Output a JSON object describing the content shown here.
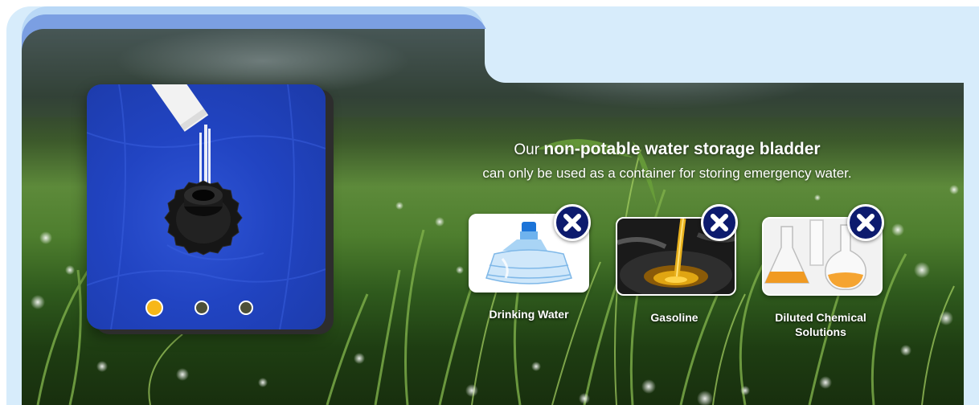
{
  "headline": {
    "prefix": "Our",
    "emphasis": "non-potable water storage bladder",
    "subline": "can only be used as a container for storing emergency water."
  },
  "items": [
    {
      "label": "Drinking Water",
      "icon": "close-icon"
    },
    {
      "label": "Gasoline",
      "icon": "close-icon"
    },
    {
      "label": "Diluted Chemical Solutions",
      "icon": "close-icon"
    }
  ],
  "carousel": {
    "slide_count": 3,
    "active_index": 0,
    "active_color": "#f7b718",
    "inactive_color": "#4d5038"
  },
  "colors": {
    "badge": "#0d1b6e",
    "bladder_blue": "#2144c2",
    "frame_light": "#d7ecfb",
    "tab_blue": "#7b9fe2"
  }
}
